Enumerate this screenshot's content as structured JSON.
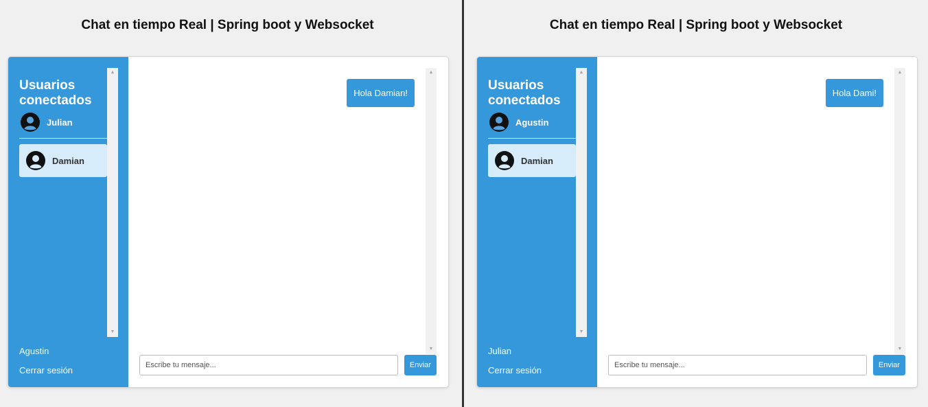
{
  "colors": {
    "accent": "#3498db",
    "selected_user_bg": "#d6ecfb",
    "page_bg": "#f0f0f0"
  },
  "panes": [
    {
      "title": "Chat en tiempo Real | Spring boot y Websocket",
      "sidebar": {
        "heading": "Usuarios conectados",
        "current_user": {
          "name": "Julian",
          "icon": "user-avatar-icon"
        },
        "users": [
          {
            "name": "Damian",
            "icon": "user-avatar-icon"
          }
        ],
        "footer_username": "Agustin",
        "logout_label": "Cerrar sesión"
      },
      "chat": {
        "messages": [
          {
            "text": "Hola Damian!",
            "direction": "sent"
          }
        ],
        "input_placeholder": "Escribe tu mensaje...",
        "input_value": "",
        "send_label": "Enviar"
      }
    },
    {
      "title": "Chat en tiempo Real | Spring boot y Websocket",
      "sidebar": {
        "heading": "Usuarios conectados",
        "current_user": {
          "name": "Agustin",
          "icon": "user-avatar-icon"
        },
        "users": [
          {
            "name": "Damian",
            "icon": "user-avatar-icon"
          }
        ],
        "footer_username": "Julian",
        "logout_label": "Cerrar sesión"
      },
      "chat": {
        "messages": [
          {
            "text": "Hola Dami!",
            "direction": "sent"
          }
        ],
        "input_placeholder": "Escribe tu mensaje...",
        "input_value": "",
        "send_label": "Enviar"
      }
    }
  ]
}
